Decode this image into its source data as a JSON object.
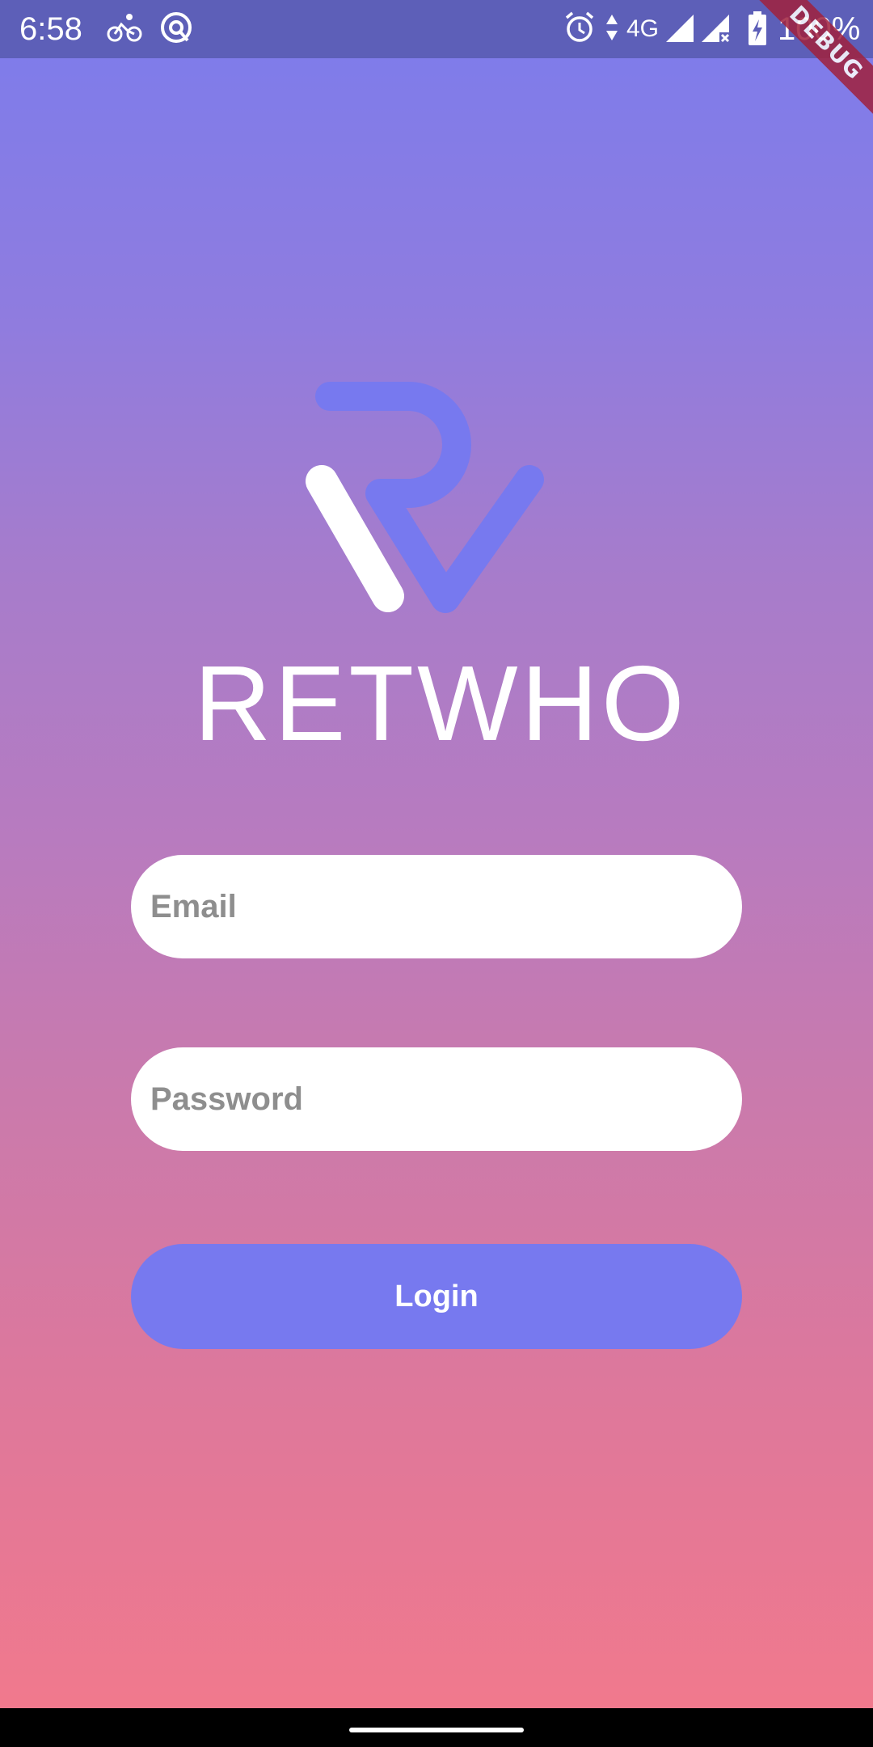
{
  "status_bar": {
    "time": "6:58",
    "network": "4G",
    "battery": "100%",
    "icons": [
      "cycling-icon",
      "data-saver-icon",
      "alarm-icon",
      "data-arrows-icon",
      "signal-icon",
      "signal-no-sim-icon",
      "battery-charging-icon"
    ]
  },
  "debug_banner": {
    "label": "DEBUG"
  },
  "brand": {
    "name": "RETWHO",
    "logo_colors": {
      "primary": "#7779ef",
      "secondary": "#ffffff"
    }
  },
  "form": {
    "email_placeholder": "Email",
    "password_placeholder": "Password",
    "login_label": "Login"
  },
  "colors": {
    "gradient_top": "#7c7cec",
    "gradient_bottom": "#f3798b",
    "status_bar": "#5d5fb8",
    "button": "#7779ef"
  }
}
